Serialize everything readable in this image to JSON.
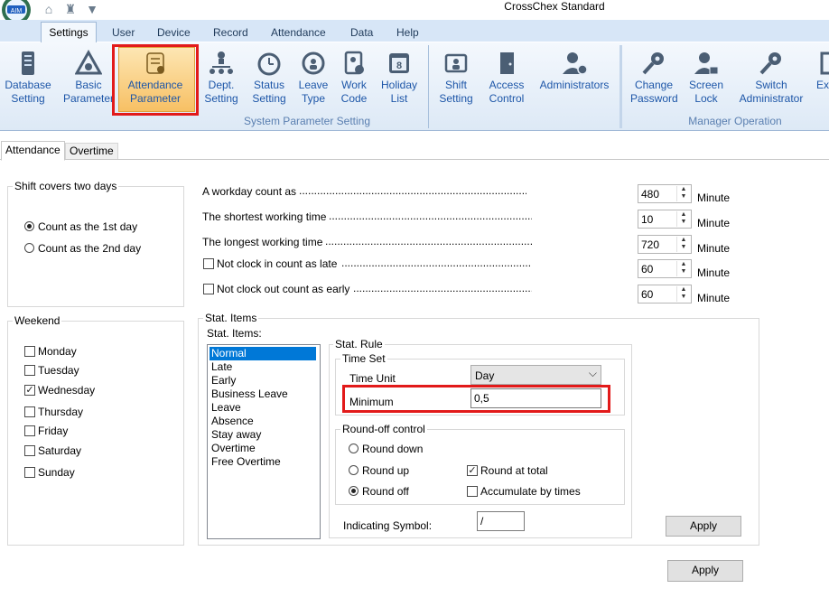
{
  "window": {
    "title": "CrossChex Standard"
  },
  "ribbon": {
    "tabs": [
      "Settings",
      "User",
      "Device",
      "Record",
      "Attendance",
      "Data",
      "Help"
    ],
    "active_tab": "Settings",
    "buttons": {
      "database_setting": "Database\nSetting",
      "basic_parameter": "Basic\nParameter",
      "attendance_parameter": "Attendance\nParameter",
      "dept_setting": "Dept.\nSetting",
      "status_setting": "Status\nSetting",
      "leave_type": "Leave\nType",
      "work_code": "Work\nCode",
      "holiday_list": "Holiday\nList",
      "shift_setting": "Shift\nSetting",
      "access_control": "Access\nControl",
      "administrators": "Administrators",
      "change_password": "Change\nPassword",
      "screen_lock": "Screen\nLock",
      "switch_administrator": "Switch\nAdministrator",
      "exit": "Exit"
    },
    "groups": {
      "system": "System Parameter Setting",
      "manager": "Manager Operation"
    }
  },
  "page_tabs": [
    "Attendance",
    "Overtime"
  ],
  "shift_box": {
    "title": "Shift covers two days",
    "option1": "Count as the 1st day",
    "option2": "Count as the 2nd day",
    "selected": 1
  },
  "weekend": {
    "title": "Weekend",
    "days": [
      "Monday",
      "Tuesday",
      "Wednesday",
      "Thursday",
      "Friday",
      "Saturday",
      "Sunday"
    ],
    "checked": [
      "Wednesday"
    ]
  },
  "params": [
    {
      "label": "A workday count as",
      "value": "480",
      "unit": "Minute",
      "checkbox": false
    },
    {
      "label": "The shortest working time",
      "value": "10",
      "unit": "Minute",
      "checkbox": false
    },
    {
      "label": "The longest working time",
      "value": "720",
      "unit": "Minute",
      "checkbox": false
    },
    {
      "label": "Not clock in count as late",
      "value": "60",
      "unit": "Minute",
      "checkbox": true
    },
    {
      "label": "Not clock out count as early",
      "value": "60",
      "unit": "Minute",
      "checkbox": true
    }
  ],
  "stat": {
    "title": "Stat. Items",
    "list_label": "Stat. Items:",
    "items": [
      "Normal",
      "Late",
      "Early",
      "Business Leave",
      "Leave",
      "Absence",
      "Stay away",
      "Overtime",
      "Free Overtime"
    ],
    "selected": "Normal",
    "rule_title": "Stat. Rule",
    "time_set_title": "Time Set",
    "time_unit_label": "Time Unit",
    "time_unit_value": "Day",
    "minimum_label": "Minimum",
    "minimum_value": "0,5",
    "roundoff_title": "Round-off control",
    "round_down": "Round down",
    "round_up": "Round up",
    "round_off": "Round off",
    "round_selected": "Round off",
    "round_at_total": "Round at total",
    "round_at_total_checked": true,
    "accumulate": "Accumulate by times",
    "accumulate_checked": false,
    "indicating_label": "Indicating Symbol:",
    "indicating_value": "/",
    "apply_label": "Apply"
  },
  "footer": {
    "apply_label": "Apply"
  },
  "colors": {
    "ribbon_text": "#1d56a8",
    "highlight": "#e21a1a",
    "selection": "#0078d7"
  }
}
